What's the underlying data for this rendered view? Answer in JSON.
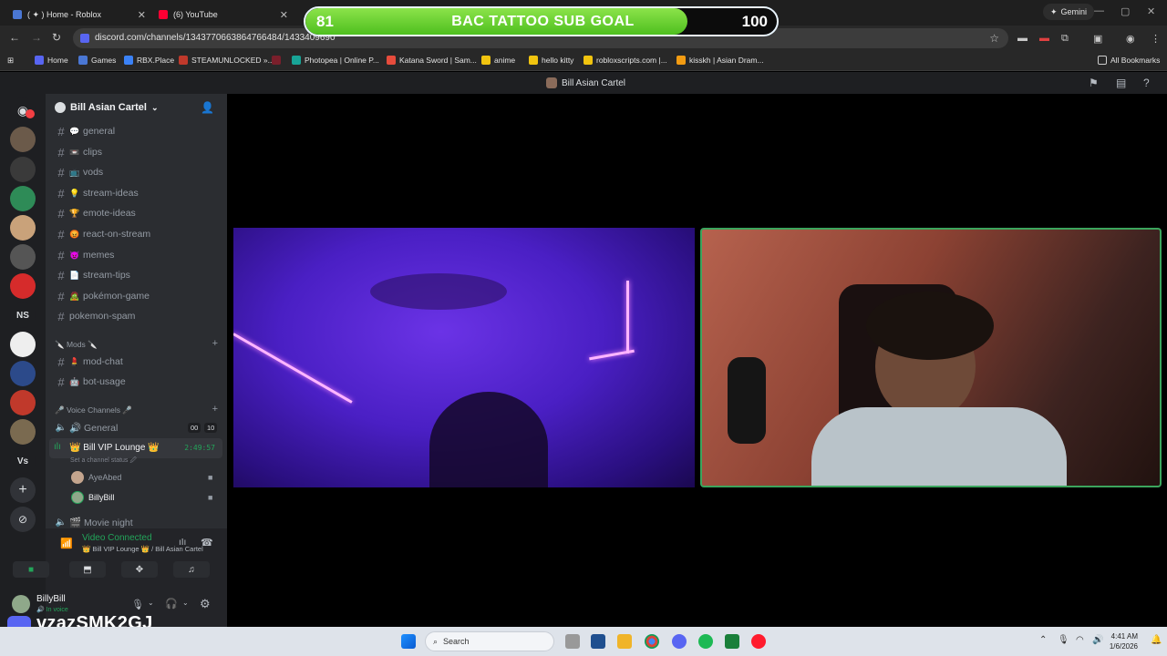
{
  "browser": {
    "tabs": [
      {
        "title": "( ✦ ) Home - Roblox",
        "close": "✕"
      },
      {
        "title": "(6) YouTube",
        "close": "✕"
      }
    ],
    "gemini_label": "Gemini",
    "url": "discord.com/channels/1343770663864766484/1433409690",
    "bookmarks": [
      {
        "label": "Home",
        "color": "#5865f2"
      },
      {
        "label": "Games",
        "color": "#4a77d4"
      },
      {
        "label": "RBX.Place",
        "color": "#3b82f6"
      },
      {
        "label": "STEAMUNLOCKED »...",
        "color": "#c0392b"
      },
      {
        "label": "Photopea | Online P...",
        "color": "#18a497"
      },
      {
        "label": "Katana Sword | Sam...",
        "color": "#e74c3c"
      },
      {
        "label": "anime",
        "color": "#f1c40f"
      },
      {
        "label": "hello kitty",
        "color": "#f1c40f"
      },
      {
        "label": "robloxscripts.com |...",
        "color": "#f1c40f"
      },
      {
        "label": "kisskh | Asian Dram...",
        "color": "#f39c12"
      }
    ],
    "all_bookmarks": "All Bookmarks"
  },
  "goal": {
    "current": "81",
    "title": "BAC TATTOO SUB GOAL",
    "max": "100",
    "progress": 0.81
  },
  "discord": {
    "window_title": "Bill Asian Cartel",
    "guild_name": "Bill Asian Cartel",
    "text_channels": [
      {
        "emoji": "💬",
        "name": "general"
      },
      {
        "emoji": "📼",
        "name": "clips"
      },
      {
        "emoji": "📺",
        "name": "vods"
      },
      {
        "emoji": "💡",
        "name": "stream-ideas"
      },
      {
        "emoji": "🏆",
        "name": "emote-ideas"
      },
      {
        "emoji": "😡",
        "name": "react-on-stream"
      },
      {
        "emoji": "😈",
        "name": "memes"
      },
      {
        "emoji": "📄",
        "name": "stream-tips"
      },
      {
        "emoji": "🧟",
        "name": "pokémon-game"
      },
      {
        "emoji": "",
        "name": "pokemon-spam"
      }
    ],
    "mods_category": "🔪 Mods 🔪",
    "mod_channels": [
      {
        "emoji": "💄",
        "name": "mod-chat"
      },
      {
        "emoji": "🤖",
        "name": "bot-usage"
      }
    ],
    "voice_category": "🎤 Voice Channels 🎤",
    "voice_channels": {
      "general": {
        "name": "🔊 General",
        "count_a": "00",
        "count_b": "10"
      },
      "vip": {
        "name": "👑 Bill VIP Lounge 👑",
        "timer": "2:49:57",
        "status": "Set a channel status 🖉"
      },
      "users": [
        {
          "name": "AyeAbed"
        },
        {
          "name": "BillyBill"
        }
      ],
      "movie": {
        "name": "🎬 Movie night"
      }
    },
    "voice_panel": {
      "status": "Video Connected",
      "channel": "👑 Bill VIP Lounge 👑 / Bill Asian Cartel"
    },
    "user": {
      "name": "BillyBill",
      "status": "🔊 In voice"
    }
  },
  "rail_texts": [
    "NS",
    "Vs"
  ],
  "overlay_username": "vzazSMK2GJ",
  "taskbar": {
    "search_placeholder": "Search",
    "time": "4:41 AM",
    "date": "1/6/2026"
  }
}
